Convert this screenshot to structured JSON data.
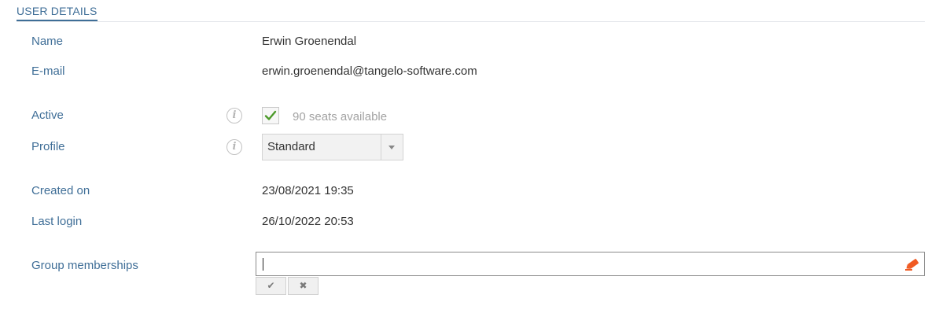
{
  "section": {
    "title": "USER DETAILS"
  },
  "fields": {
    "name": {
      "label": "Name",
      "value": "Erwin Groenendal"
    },
    "email": {
      "label": "E-mail",
      "value": "erwin.groenendal@tangelo-software.com"
    },
    "active": {
      "label": "Active",
      "checked": true,
      "seats_text": "90 seats available"
    },
    "profile": {
      "label": "Profile",
      "selected": "Standard"
    },
    "created_on": {
      "label": "Created on",
      "value": "23/08/2021 19:35"
    },
    "last_login": {
      "label": "Last login",
      "value": "26/10/2022 20:53"
    },
    "group_memberships": {
      "label": "Group memberships",
      "value": ""
    }
  },
  "icons": {
    "info": "info-icon",
    "check": "checkmark-icon",
    "dropdown": "chevron-down-icon",
    "edit": "pencil-icon",
    "confirm": "check-icon",
    "cancel": "close-icon"
  },
  "glyphs": {
    "info": "i",
    "confirm": "✔",
    "cancel": "✖"
  },
  "colors": {
    "label": "#3f6e97",
    "value": "#333333",
    "muted": "#a3a3a3",
    "check_green": "#4c9a2a",
    "edit_orange": "#f05a22"
  }
}
